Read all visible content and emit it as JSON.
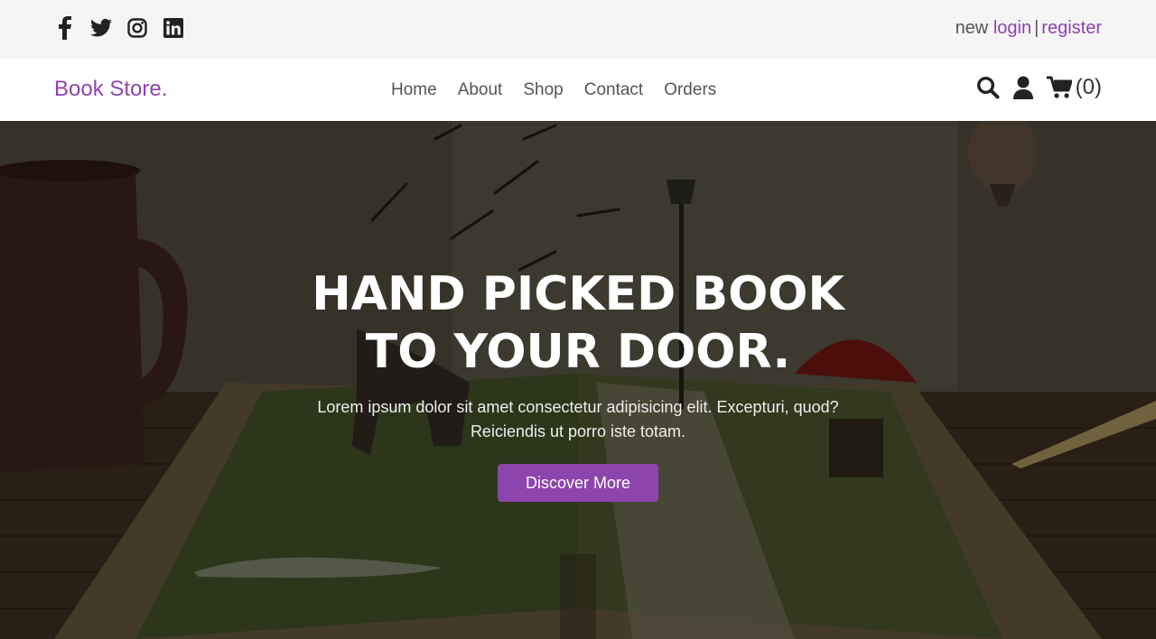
{
  "topbar": {
    "socials": [
      {
        "icon": "facebook-icon"
      },
      {
        "icon": "twitter-icon"
      },
      {
        "icon": "instagram-icon"
      },
      {
        "icon": "linkedin-icon"
      }
    ],
    "auth": {
      "prefix": "new",
      "login": "login",
      "separator": "|",
      "register": "register"
    }
  },
  "header": {
    "logo": "Book Store.",
    "nav": [
      "Home",
      "About",
      "Shop",
      "Contact",
      "Orders"
    ],
    "cart_count": "(0)"
  },
  "hero": {
    "title_line1": "HAND PICKED BOOK",
    "title_line2": "TO YOUR DOOR.",
    "text": "Lorem ipsum dolor sit amet consectetur adipisicing elit. Excepturi, quod? Reiciendis ut porro iste totam.",
    "button": "Discover More"
  },
  "colors": {
    "accent": "#8e44ad",
    "topbar_bg": "#f5f5f5",
    "header_bg": "#ffffff"
  }
}
